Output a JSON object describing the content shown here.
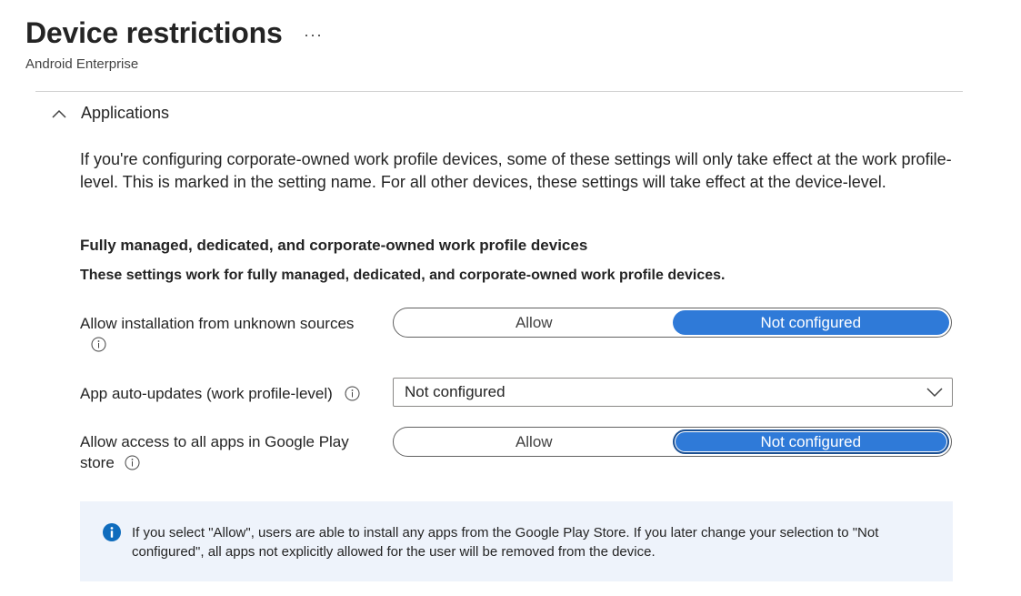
{
  "header": {
    "title": "Device restrictions",
    "subtitle": "Android Enterprise",
    "more_label": "···"
  },
  "section": {
    "title": "Applications",
    "intro": "If you're configuring corporate-owned work profile devices, some of these settings will only take effect at the work profile-level. This is marked in the setting name. For all other devices, these settings will take effect at the device-level.",
    "group_heading": "Fully managed, dedicated, and corporate-owned work profile devices",
    "group_description": "These settings work for fully managed, dedicated, and corporate-owned work profile devices."
  },
  "settings": [
    {
      "label": "Allow installation from unknown sources",
      "type": "toggle",
      "options": [
        "Allow",
        "Not configured"
      ],
      "selected": "Not configured"
    },
    {
      "label": "App auto-updates (work profile-level)",
      "type": "dropdown",
      "value": "Not configured"
    },
    {
      "label": "Allow access to all apps in Google Play store",
      "type": "toggle",
      "options": [
        "Allow",
        "Not configured"
      ],
      "selected": "Not configured"
    }
  ],
  "info_banner": {
    "text": "If you select \"Allow\", users are able to install any apps from the Google Play Store. If you later change your selection to \"Not configured\", all apps not explicitly allowed for the user will be removed from the device."
  },
  "colors": {
    "accent": "#2f7ad8",
    "banner_bg": "#eef3fb",
    "info_icon": "#0f6cbd"
  }
}
